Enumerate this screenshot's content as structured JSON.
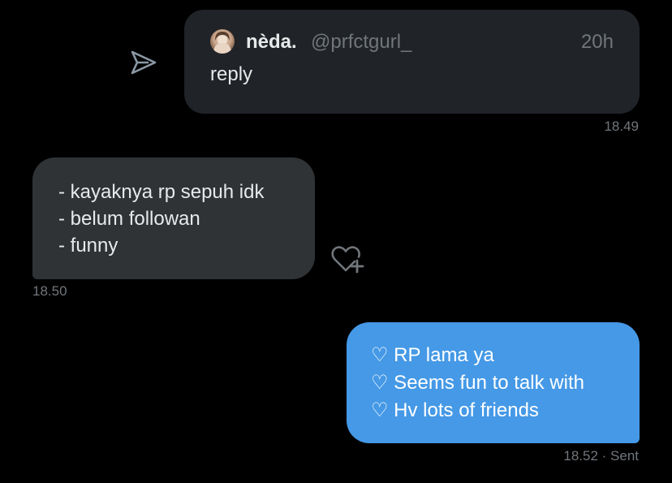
{
  "quoted_post": {
    "display_name": "nèda.",
    "handle": "@prfctgurl_",
    "time_ago": "20h",
    "text": "reply",
    "sent_time": "18.49"
  },
  "received_message": {
    "lines": [
      "- kayaknya rp sepuh idk",
      "- belum followan",
      "- funny"
    ],
    "time": "18.50"
  },
  "sent_message": {
    "lines": [
      "♡ RP lama ya",
      "♡ Seems fun to talk with",
      "♡ Hv lots of friends"
    ],
    "time": "18.52",
    "status": "· Sent"
  },
  "icons": {
    "share": "send-icon",
    "react": "heart-plus-icon"
  },
  "colors": {
    "background": "#000000",
    "received_bubble": "#2f3336",
    "sent_bubble": "#4599e6",
    "quoted_card": "#202327",
    "muted_text": "#71767b"
  }
}
